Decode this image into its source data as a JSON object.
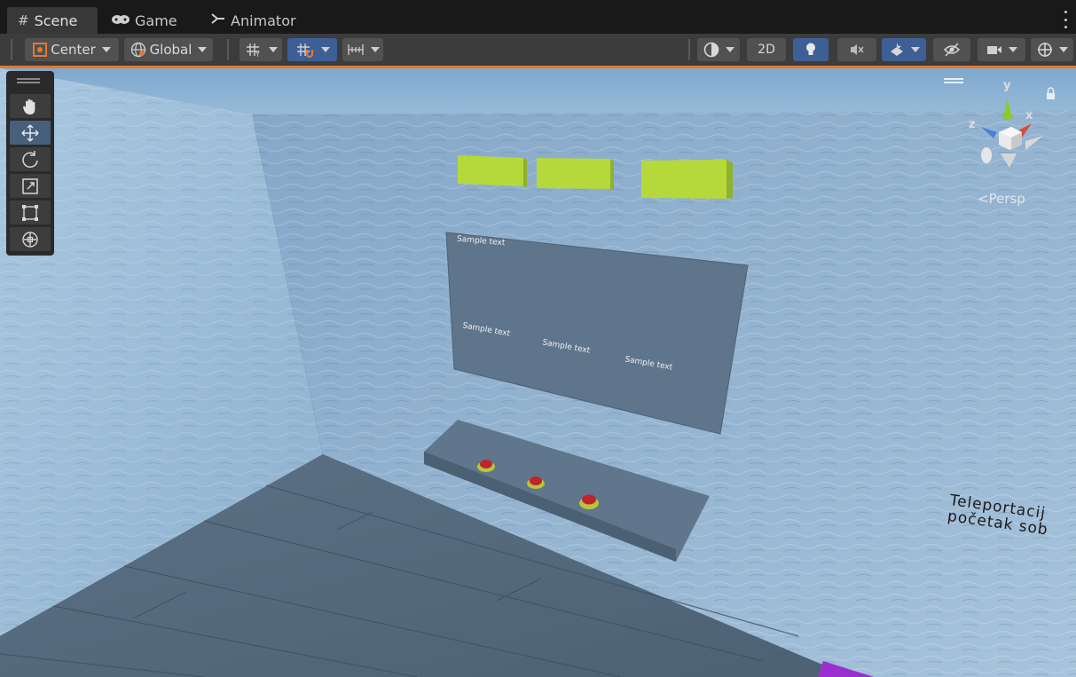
{
  "tabs": [
    {
      "label": "Scene",
      "icon": "hash-icon"
    },
    {
      "label": "Game",
      "icon": "gamepad-icon"
    },
    {
      "label": "Animator",
      "icon": "animator-icon"
    }
  ],
  "toolbar": {
    "pivot_label": "Center",
    "space_label": "Global",
    "mode_2d_label": "2D"
  },
  "scene": {
    "persp_label": "Persp",
    "panel_texts": [
      "Sample text",
      "Sample text",
      "Sample text",
      "Sample text"
    ],
    "teleport_lines": [
      "Teleportacij",
      "početak sob"
    ],
    "gizmo_axes": {
      "y": "y",
      "x": "x",
      "z": "z"
    }
  },
  "colors": {
    "accent_orange": "#e5782d",
    "active_blue": "#3e5f96",
    "button_yellow_green": "#b5d93a",
    "button_red": "#c0232b",
    "purple_object": "#9b2fd0"
  }
}
